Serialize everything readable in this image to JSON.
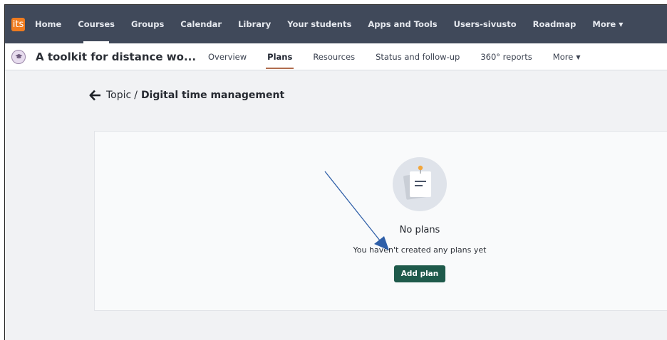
{
  "topnav": {
    "logo_text": "its",
    "items": [
      {
        "label": "Home"
      },
      {
        "label": "Courses"
      },
      {
        "label": "Groups"
      },
      {
        "label": "Calendar"
      },
      {
        "label": "Library"
      },
      {
        "label": "Your students"
      },
      {
        "label": "Apps and Tools"
      },
      {
        "label": "Users-sivusto"
      },
      {
        "label": "Roadmap"
      },
      {
        "label": "More"
      }
    ],
    "active_item": "Courses",
    "background_color": "#40495a",
    "logo_color": "#f07c1f"
  },
  "course": {
    "title": "A toolkit for distance wo...",
    "tabs": [
      {
        "label": "Overview"
      },
      {
        "label": "Plans"
      },
      {
        "label": "Resources"
      },
      {
        "label": "Status and follow-up"
      },
      {
        "label": "360° reports"
      },
      {
        "label": "More"
      }
    ],
    "active_tab": "Plans",
    "active_underline_color": "#b06d4e"
  },
  "breadcrumb": {
    "topic": "Topic",
    "separator": "/",
    "current": "Digital time management"
  },
  "empty_state": {
    "title": "No plans",
    "text": "You haven't created any plans yet",
    "button_label": "Add plan",
    "button_color": "#1f5a4b"
  },
  "annotation": {
    "type": "arrow",
    "color": "#2f5fa8"
  }
}
